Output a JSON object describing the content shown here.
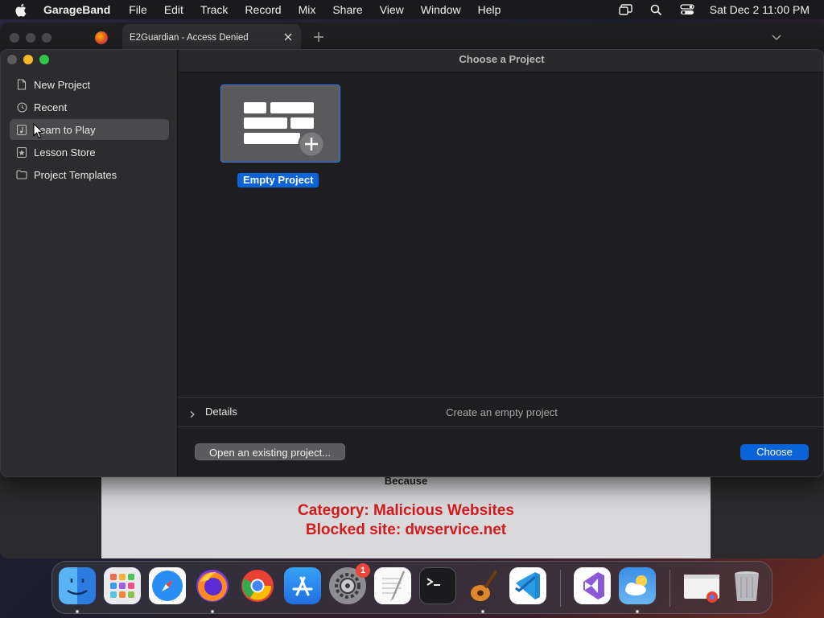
{
  "menubar": {
    "app_name": "GarageBand",
    "items": [
      "File",
      "Edit",
      "Track",
      "Record",
      "Mix",
      "Share",
      "View",
      "Window",
      "Help"
    ],
    "clock": "Sat Dec 2  11:00 PM"
  },
  "browser": {
    "tab_title": "E2Guardian - Access Denied",
    "page": {
      "because_text": "Because",
      "category_text": "Category: Malicious Websites",
      "blocked_text": "Blocked site: dwservice.net"
    }
  },
  "garageband": {
    "window_title": "Choose a Project",
    "sidebar": {
      "items": [
        {
          "label": "New Project",
          "icon": "document-icon"
        },
        {
          "label": "Recent",
          "icon": "clock-icon"
        },
        {
          "label": "Learn to Play",
          "icon": "music-note-icon"
        },
        {
          "label": "Lesson Store",
          "icon": "star-icon"
        },
        {
          "label": "Project Templates",
          "icon": "folder-icon"
        }
      ],
      "selected": "Learn to Play"
    },
    "tile_label": "Empty Project",
    "details_label": "Details",
    "details_description": "Create an empty project",
    "open_button": "Open an existing project...",
    "choose_button": "Choose"
  },
  "dock": {
    "apps": [
      "Finder",
      "Launchpad",
      "Safari",
      "Firefox",
      "Chrome",
      "App Store",
      "System Settings",
      "TextEdit",
      "Terminal",
      "GarageBand",
      "Visual Studio Code",
      "Visual Studio",
      "Weather",
      "Chrome window",
      "Trash"
    ],
    "settings_badge": "1"
  },
  "colors": {
    "accent_blue": "#0a63d8",
    "blocked_red": "#d21b1b"
  }
}
